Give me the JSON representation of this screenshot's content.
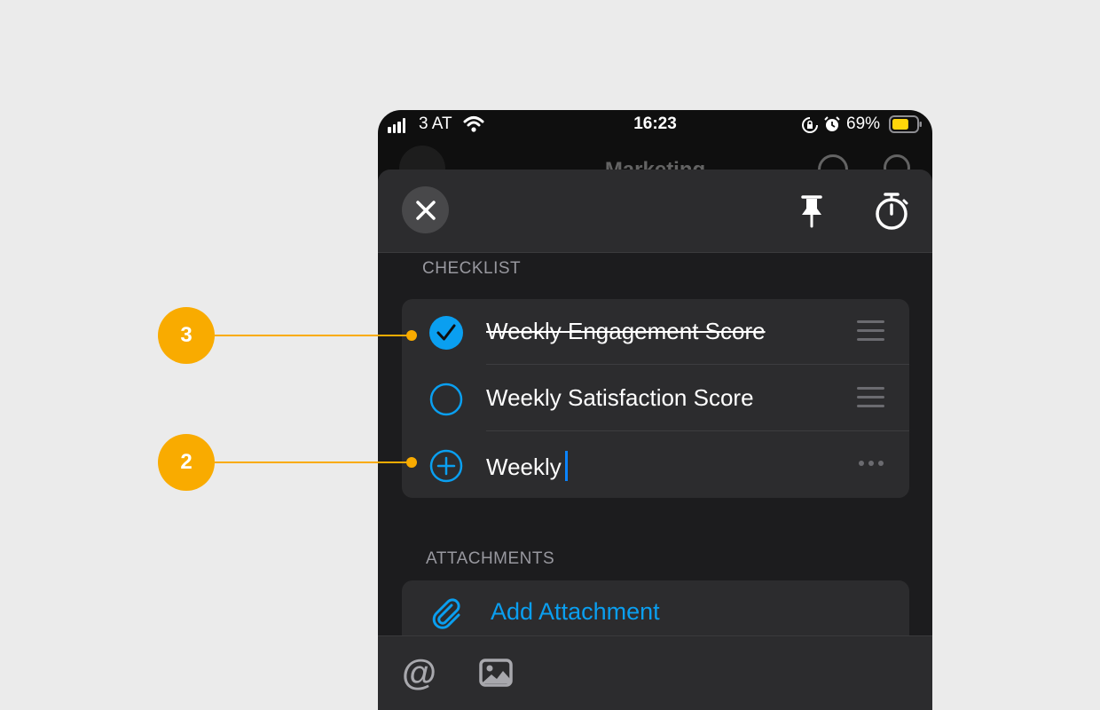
{
  "status_bar": {
    "carrier": "3 AT",
    "time": "16:23",
    "battery_percent": "69%",
    "battery_level": 0.69
  },
  "background_header": {
    "title": "Marketing"
  },
  "sheet": {
    "checklist_label": "CHECKLIST",
    "checklist_items": [
      {
        "text": "Weekly Engagement Score",
        "checked": true
      },
      {
        "text": "Weekly Satisfaction Score",
        "checked": false
      }
    ],
    "new_item_input": {
      "value": "Weekly"
    },
    "attachments_label": "ATTACHMENTS",
    "add_attachment_label": "Add Attachment"
  },
  "bottom_bar": {
    "mention_symbol": "@"
  },
  "callouts": [
    {
      "number": "3"
    },
    {
      "number": "2"
    }
  ],
  "colors": {
    "accent_blue": "#0a9ff0",
    "callout_orange": "#f9ab00",
    "battery_yellow": "#ffd60a",
    "sheet_background": "#1c1c1e",
    "card_background": "#2c2c2e"
  }
}
